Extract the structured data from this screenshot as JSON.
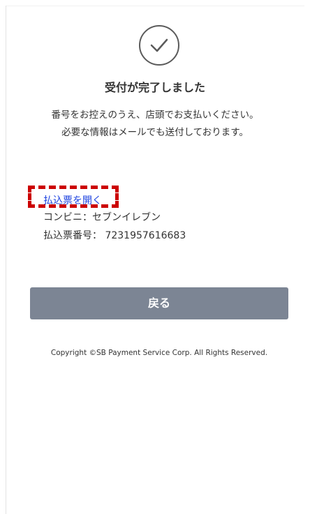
{
  "status": {
    "icon": "check-circle-icon",
    "title": "受付が完了しました",
    "message_line1": "番号をお控えのうえ、店頭でお支払いください。",
    "message_line2": "必要な情報はメールでも送付しております。"
  },
  "payment": {
    "open_slip_link": "払込票を開く",
    "store_text": "コンビニ：セブンイレブン",
    "slip_number_text": "払込票番号： 7231957616683"
  },
  "actions": {
    "back_button": "戻る"
  },
  "footer": {
    "copyright": "Copyright ©SB Payment Service Corp. All Rights Reserved."
  },
  "colors": {
    "link": "#1f44e0",
    "highlight_border": "#cc0000",
    "button_bg": "#7c8594"
  }
}
